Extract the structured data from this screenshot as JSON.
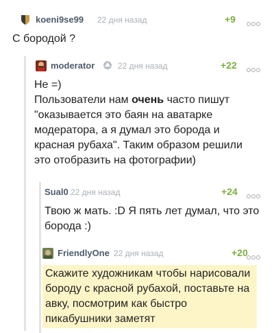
{
  "comments": [
    {
      "username": "koeni9se99",
      "time": "22 дня назад",
      "rating": "+9",
      "text": "С бородой ?",
      "avatar": "shield-avatar-icon"
    },
    {
      "username": "moderator",
      "time": "22 дня назад",
      "rating": "+22",
      "text_line1": "Не =)",
      "text_p2_before": "Пользователи нам ",
      "text_p2_bold": "очень",
      "text_p2_after": " часто пишут \"оказывается это баян на аватарке модератора, а я думал это борода и красная рубаха\". Таким образом решили это отобразить на фотографии)",
      "avatar": "moderator-avatar-icon",
      "badge": "moderator-badge-icon"
    },
    {
      "username": "Sual0",
      "time": "22 дня назад",
      "rating": "+24",
      "text": "Твою ж мать. :D Я пять лет думал, что это борода :)"
    },
    {
      "username": "FriendlyOne",
      "time": "22 дня назад",
      "rating": "+20",
      "text": "Скажите художникам чтобы нарисовали бороду с красной рубахой, поставьте на авку, посмотрим как быстро пикабушники заметят",
      "avatar": "friendlyone-avatar-icon"
    }
  ],
  "colors": {
    "username": "#4c5b6b",
    "rating": "#7cae3e",
    "time": "#aab0b5",
    "highlight": "#fdf5c8",
    "thread_line": "#e3e3e3"
  }
}
